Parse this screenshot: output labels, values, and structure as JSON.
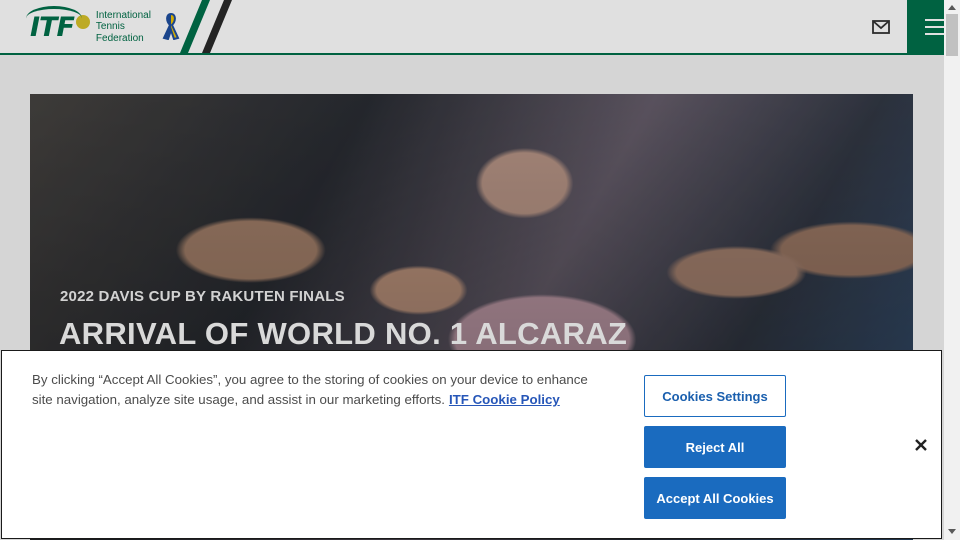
{
  "header": {
    "logo_abbr": "ITF",
    "logo_line1": "International",
    "logo_line2": "Tennis",
    "logo_line3": "Federation",
    "mail_icon": "mail-icon",
    "menu_icon": "hamburger-menu-icon"
  },
  "hero": {
    "subtitle": "2022 Davis Cup by Rakuten Finals",
    "title": "Arrival of World No. 1 Alcaraz"
  },
  "cookie_banner": {
    "text": "By clicking “Accept All Cookies”, you agree to the storing of cookies on your device to enhance site navigation, analyze site usage, and assist in our marketing efforts.",
    "policy_link": "ITF Cookie Policy",
    "settings_button": "Cookies Settings",
    "reject_button": "Reject All",
    "accept_button": "Accept All Cookies",
    "close_icon": "close-icon"
  },
  "colors": {
    "brand_green": "#00704a",
    "button_blue": "#1a6bbf",
    "link_blue": "#2656b8"
  }
}
